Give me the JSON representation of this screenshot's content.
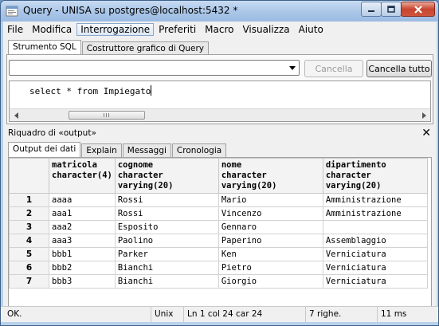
{
  "window": {
    "title": "Query - UNISA su postgres@localhost:5432 *"
  },
  "menu": [
    "File",
    "Modifica",
    "Interrogazione",
    "Preferiti",
    "Macro",
    "Visualizza",
    "Aiuto"
  ],
  "menu_active": "Interrogazione",
  "top_tabs": [
    "Strumento SQL",
    "Costruttore grafico di Query"
  ],
  "sql": {
    "combo_value": "",
    "cancel_label": "Cancella",
    "cancel_all_label": "Cancella tutto",
    "query_text": "select * from Impiegato",
    "scroll_grip": "III"
  },
  "output": {
    "title": "Riquadro di «output»",
    "close_glyph": "✕",
    "tabs": [
      "Output dei dati",
      "Explain",
      "Messaggi",
      "Cronologia"
    ]
  },
  "table": {
    "columns": [
      {
        "name": "matricola",
        "type": "character(4)"
      },
      {
        "name": "cognome",
        "type": "character varying(20)"
      },
      {
        "name": "nome",
        "type": "character varying(20)"
      },
      {
        "name": "dipartimento",
        "type": "character varying(20)"
      }
    ],
    "rows": [
      {
        "n": "1",
        "cells": [
          "aaaa",
          "Rossi",
          "Mario",
          "Amministrazione"
        ]
      },
      {
        "n": "2",
        "cells": [
          "aaa1",
          "Rossi",
          "Vincenzo",
          "Amministrazione"
        ]
      },
      {
        "n": "3",
        "cells": [
          "aaa2",
          "Esposito",
          "Gennaro",
          ""
        ]
      },
      {
        "n": "4",
        "cells": [
          "aaa3",
          "Paolino",
          "Paperino",
          "Assemblaggio"
        ]
      },
      {
        "n": "5",
        "cells": [
          "bbb1",
          "Parker",
          "Ken",
          "Verniciatura"
        ]
      },
      {
        "n": "6",
        "cells": [
          "bbb2",
          "Bianchi",
          "Pietro",
          "Verniciatura"
        ]
      },
      {
        "n": "7",
        "cells": [
          "bbb3",
          "Bianchi",
          "Giorgio",
          "Verniciatura"
        ]
      }
    ]
  },
  "status": {
    "message": "OK.",
    "line_endings": "Unix",
    "position": "Ln 1 col 24 car 24",
    "rows": "7 righe.",
    "time": "11 ms"
  },
  "colors": {
    "title_bar": "#a9c6e8",
    "close_button": "#c8452f",
    "window_frame": "#b9d1ea"
  }
}
